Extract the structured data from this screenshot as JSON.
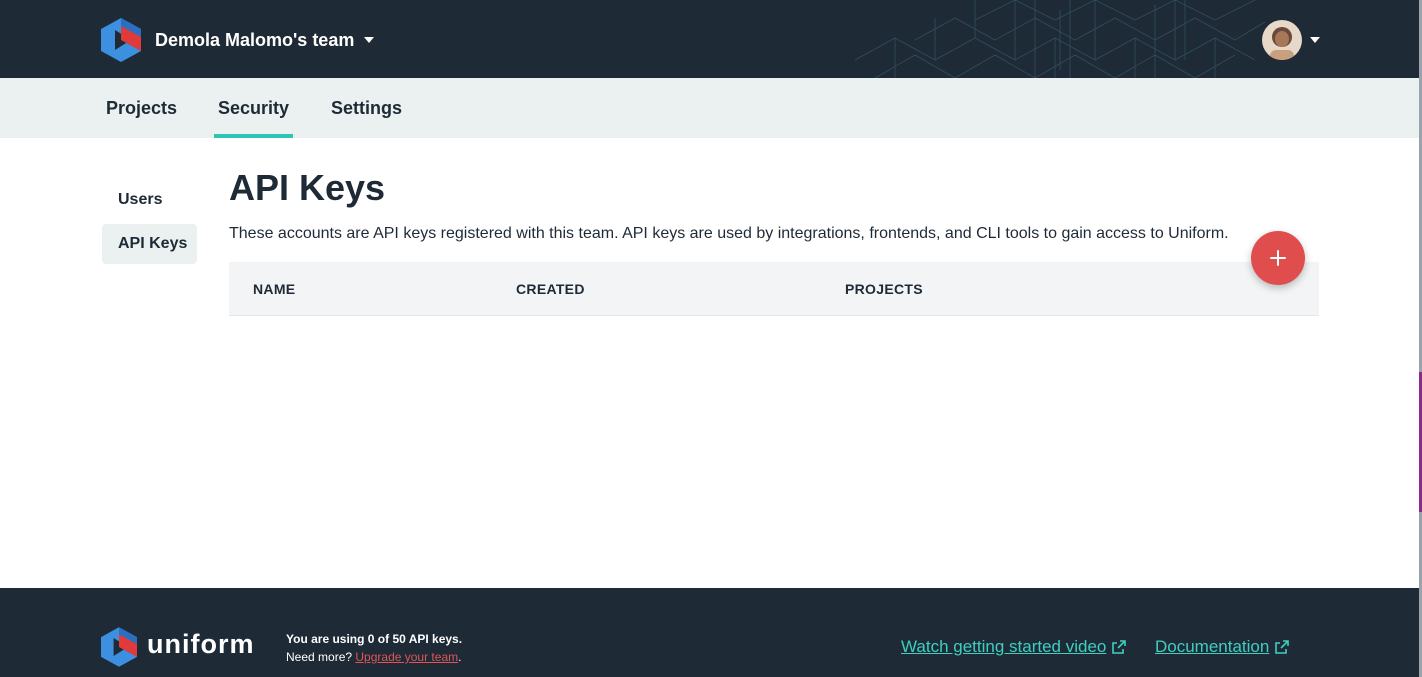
{
  "header": {
    "team_name": "Demola Malomo's team"
  },
  "tabs": [
    {
      "label": "Projects",
      "active": false
    },
    {
      "label": "Security",
      "active": true
    },
    {
      "label": "Settings",
      "active": false
    }
  ],
  "sidebar": {
    "items": [
      {
        "label": "Users",
        "active": false
      },
      {
        "label": "API Keys",
        "active": true
      }
    ]
  },
  "main": {
    "title": "API Keys",
    "description": "These accounts are API keys registered with this team. API keys are used by integrations, frontends, and CLI tools to gain access to Uniform.",
    "table": {
      "columns": [
        "NAME",
        "CREATED",
        "PROJECTS"
      ],
      "rows": []
    },
    "add_button_icon": "plus-icon"
  },
  "footer": {
    "brand": "uniform",
    "usage_text": "You are using 0 of 50 API keys.",
    "need_more": "Need more?",
    "upgrade_link": "Upgrade your team",
    "period": ".",
    "links": [
      {
        "label": "Watch getting started video",
        "icon": "external-link-icon"
      },
      {
        "label": "Documentation",
        "icon": "external-link-icon"
      }
    ]
  },
  "colors": {
    "navy": "#1e2a36",
    "tab_bar": "#ebf1f1",
    "accent_teal": "#2ec4b6",
    "fab_red": "#e04d4d",
    "footer_link": "#3ecfc0",
    "logo_blue": "#3d8fe0",
    "logo_red": "#e03a3a"
  }
}
